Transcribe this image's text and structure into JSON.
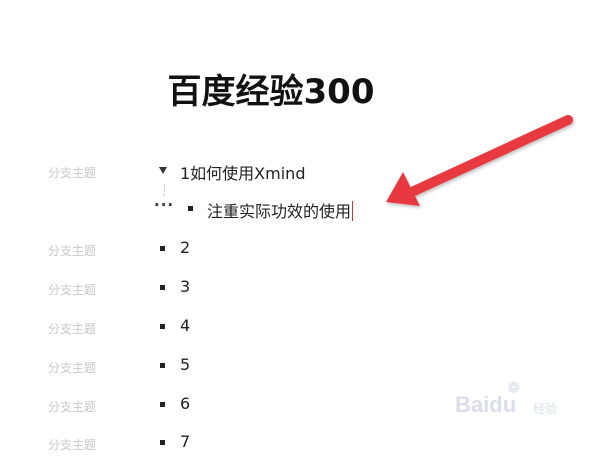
{
  "page": {
    "title": "百度经验300"
  },
  "outline": {
    "branch_placeholder": "分支主题",
    "rows": [
      {
        "label": "1如何使用Xmind",
        "expanded": true
      },
      {
        "label": "注重实际功效的使用",
        "level": 2,
        "editing": true
      },
      {
        "label": "2"
      },
      {
        "label": "3"
      },
      {
        "label": "4"
      },
      {
        "label": "5"
      },
      {
        "label": "6"
      },
      {
        "label": "7"
      }
    ]
  },
  "annotation": {
    "arrow_color": "#e8393f"
  },
  "watermark": {
    "brand": "Bai",
    "brand_tail": "du",
    "suffix": "经验"
  }
}
